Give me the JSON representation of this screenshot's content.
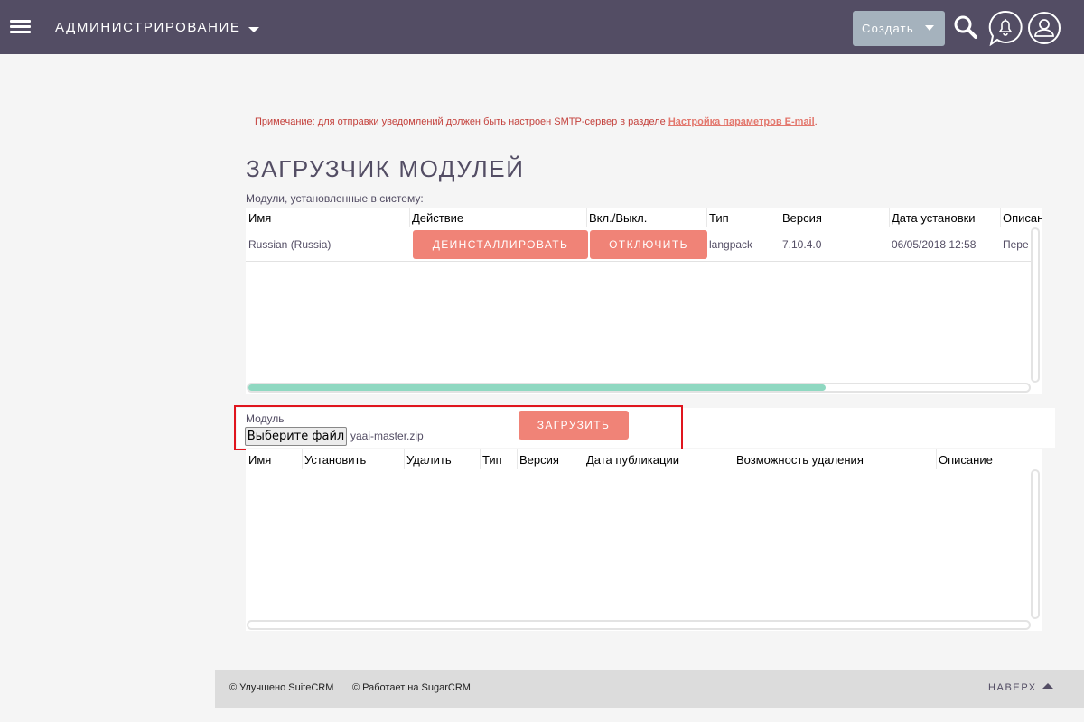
{
  "topbar": {
    "module_title": "АДМИНИСТРИРОВАНИЕ",
    "create_label": "Создать",
    "icons": [
      "menu-icon",
      "search-icon",
      "notification-bell-icon",
      "user-avatar-icon"
    ],
    "bg_color": "#534d64"
  },
  "notice": {
    "text": "Примечание: для отправки уведомлений должен быть настроен SMTP-сервер в разделе ",
    "link_text": "Настройка параметров E-mail",
    "suffix": "."
  },
  "page_title": "ЗАГРУЗЧИК МОДУЛЕЙ",
  "installed": {
    "caption": "Модули, установленные в систему:",
    "columns": [
      "Имя",
      "Действие",
      "Вкл./Выкл.",
      "Тип",
      "Версия",
      "Дата установки",
      "Описание"
    ],
    "rows": [
      {
        "name": "Russian (Russia)",
        "uninstall_label": "ДЕИНСТАЛЛИРОВАТЬ",
        "disable_label": "ОТКЛЮЧИТЬ",
        "type": "langpack",
        "version": "7.10.4.0",
        "installed_at": "06/05/2018 12:58",
        "description": "Пере"
      }
    ],
    "hscroll_fraction": 0.74
  },
  "upload": {
    "module_label": "Модуль",
    "choose_file_label": "Выберите файл",
    "file_name": "yaai-master.zip",
    "upload_label": "ЗАГРУЗИТЬ"
  },
  "available": {
    "columns": [
      "Имя",
      "Установить",
      "Удалить",
      "Тип",
      "Версия",
      "Дата публикации",
      "Возможность удаления",
      "Описание"
    ]
  },
  "footer": {
    "suitecrm": "© Улучшено SuiteCRM",
    "sugarcrm": "© Работает на SugarCRM",
    "back_to_top": "НАВЕРХ"
  },
  "colors": {
    "accent_button": "#f08377",
    "create_button": "#a5b2bd",
    "scroll_thumb": "#8fd8c1",
    "highlight": "#e0151e"
  }
}
